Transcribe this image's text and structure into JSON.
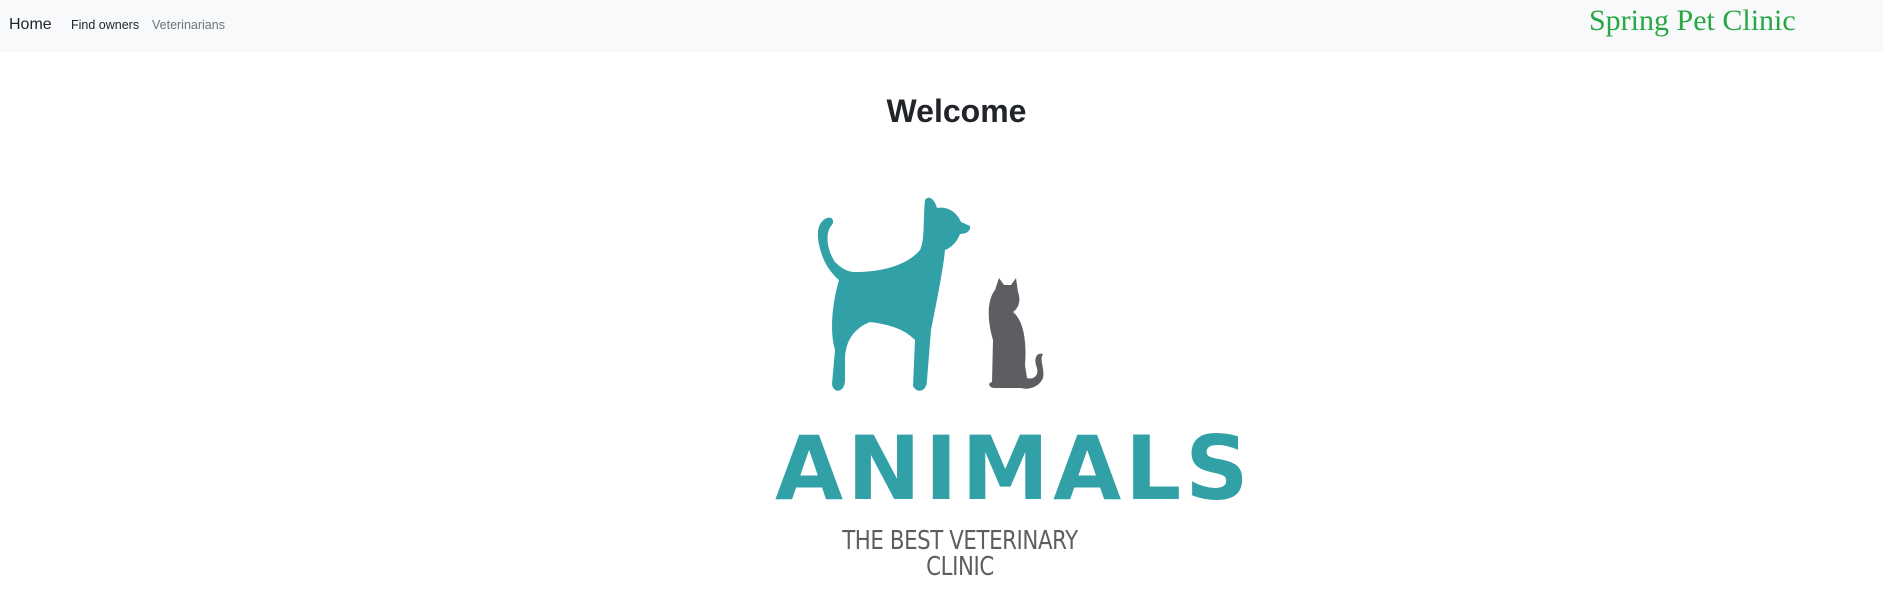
{
  "navbar": {
    "brand": "Home",
    "links": [
      "Find owners",
      "Veterinarians"
    ],
    "clinic_title": "Spring Pet Clinic"
  },
  "main": {
    "heading": "Welcome",
    "logo": {
      "icon": "dog-and-cat-silhouette",
      "word": "ANIMALS",
      "tagline": "THE BEST VETERINARY CLINIC",
      "colors": {
        "teal": "#31a1a7",
        "gray": "#5d5e62"
      }
    }
  },
  "colors": {
    "navbar_bg": "#f8f9fa",
    "clinic_title": "#28a745"
  }
}
